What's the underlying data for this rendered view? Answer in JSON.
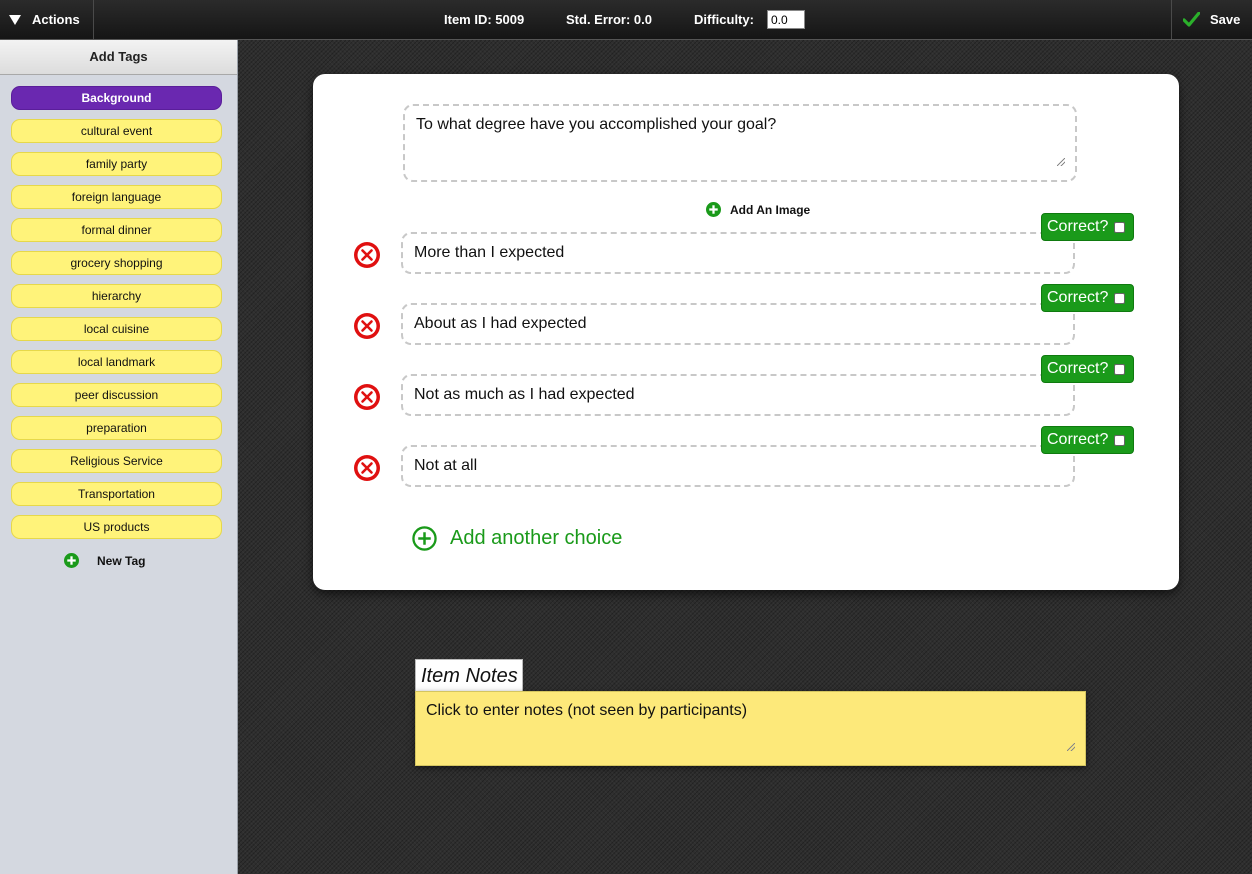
{
  "topbar": {
    "actions_label": "Actions",
    "item_id": "Item ID: 5009",
    "std_error": "Std. Error: 0.0",
    "difficulty_label": "Difficulty:",
    "difficulty_value": "0.0",
    "save_label": "Save"
  },
  "sidebar": {
    "header": "Add Tags",
    "tags": [
      {
        "label": "Background",
        "active": true
      },
      {
        "label": "cultural event",
        "active": false
      },
      {
        "label": "family party",
        "active": false
      },
      {
        "label": "foreign language",
        "active": false
      },
      {
        "label": "formal dinner",
        "active": false
      },
      {
        "label": "grocery shopping",
        "active": false
      },
      {
        "label": "hierarchy",
        "active": false
      },
      {
        "label": "local cuisine",
        "active": false
      },
      {
        "label": "local landmark",
        "active": false
      },
      {
        "label": "peer discussion",
        "active": false
      },
      {
        "label": "preparation",
        "active": false
      },
      {
        "label": "Religious Service",
        "active": false
      },
      {
        "label": "Transportation",
        "active": false
      },
      {
        "label": "US products",
        "active": false
      }
    ],
    "new_tag_label": "New Tag"
  },
  "card": {
    "question": "To what degree have you accomplished your goal?",
    "add_image_label": "Add An Image",
    "choices": [
      {
        "text": "More than I expected",
        "correct_label": "Correct?",
        "correct": false
      },
      {
        "text": "About as I had expected",
        "correct_label": "Correct?",
        "correct": false
      },
      {
        "text": "Not as much as I had expected",
        "correct_label": "Correct?",
        "correct": false
      },
      {
        "text": "Not at all",
        "correct_label": "Correct?",
        "correct": false
      }
    ],
    "add_choice_label": "Add another choice"
  },
  "notes": {
    "tab_label": "Item Notes",
    "placeholder": "Click to enter notes (not seen by participants)"
  },
  "colors": {
    "accent_green": "#1a9a1a",
    "active_tag": "#6a28b0",
    "tag_yellow": "#fff37a",
    "remove_red": "#e01010",
    "notes_yellow": "#fde97a"
  },
  "icons": {
    "actions": "triangle-down-icon",
    "save": "checkmark-icon",
    "add": "plus-circle-icon",
    "remove": "x-circle-icon"
  }
}
